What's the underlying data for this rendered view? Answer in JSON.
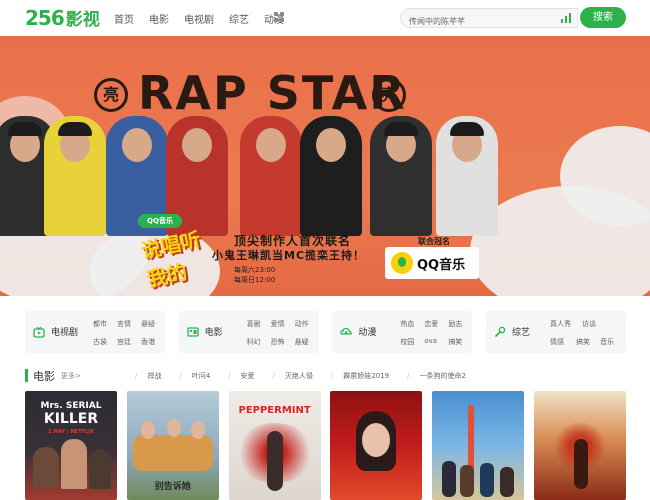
{
  "header": {
    "logo_num": "256",
    "logo_cn": "影视",
    "nav": [
      "首页",
      "电影",
      "电视剧",
      "综艺",
      "动漫"
    ],
    "search_placeholder": "传闻中的陈芊芊",
    "search_button": "搜索",
    "brand_color": "#2bb24c"
  },
  "banner": {
    "title": "RAP STAR",
    "badge_char": "亮",
    "qq_badge": "QQ音乐",
    "tagline1": "顶尖制作人首次联名",
    "tagline2": "小鬼王琳凯当MC揽栾王持！",
    "schedule1": "每周六23:00",
    "schedule2": "每周日12:00",
    "sponsor_label": "联合冠名",
    "sponsor_text": "QQ音乐",
    "show_logo": "说唱听我的"
  },
  "categories": [
    {
      "title": "电视剧",
      "icon": "tv-icon",
      "links": [
        "都市",
        "言情",
        "悬疑",
        "古装",
        "宫廷",
        "香港"
      ]
    },
    {
      "title": "电影",
      "icon": "film-icon",
      "links": [
        "喜剧",
        "爱情",
        "动作",
        "科幻",
        "恐怖",
        "悬疑"
      ]
    },
    {
      "title": "动漫",
      "icon": "cloud-icon",
      "links": [
        "热血",
        "恋爱",
        "励志",
        "校园",
        "ova",
        "搞笑"
      ]
    },
    {
      "title": "综艺",
      "icon": "mic-icon",
      "links": [
        "真人秀",
        "访谈",
        "情感",
        "搞笑",
        "音乐"
      ]
    }
  ],
  "movies_section": {
    "title": "电影",
    "more": "更多>",
    "tags": [
      "捍战",
      "叶问4",
      "安爱",
      "灭绝人侵",
      "霹雳娇娃2019",
      "一条狗的使命2"
    ]
  },
  "posters": [
    {
      "name": "mrs-serial-killer",
      "line1": "Mrs. SERIAL",
      "line2": "KILLER",
      "sub": "1 MAY | NETFLIX",
      "bg": "#2b2b33"
    },
    {
      "name": "family-poster",
      "line1": "别告诉她",
      "line2": "",
      "sub": "",
      "bg": "#9fb7c9"
    },
    {
      "name": "peppermint",
      "line1": "PEPPERMINT",
      "line2": "",
      "sub": "",
      "bg": "#e7e3de"
    },
    {
      "name": "mulan",
      "line1": "",
      "line2": "",
      "sub": "",
      "bg": "#b31d1d"
    },
    {
      "name": "city-poster",
      "line1": "",
      "line2": "",
      "sub": "",
      "bg": "#5aa0d8"
    },
    {
      "name": "fantasy-poster",
      "line1": "",
      "line2": "",
      "sub": "",
      "bg": "#c8623a"
    }
  ]
}
